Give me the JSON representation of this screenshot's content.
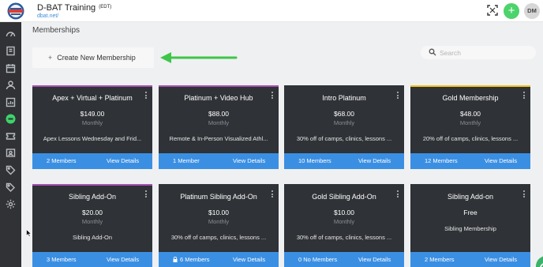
{
  "header": {
    "title": "D-BAT Training",
    "timezone": "(EDT)",
    "url": "dbat.net/",
    "add_symbol": "+",
    "avatar_initials": "DM",
    "icons": [
      "logo-icon",
      "qr-scan-icon",
      "plus-icon"
    ]
  },
  "sidebar": {
    "icons": [
      "dashboard-icon",
      "book-icon",
      "calendar-icon",
      "users-icon",
      "report-icon",
      "dbat-icon",
      "ticket-icon",
      "id-card-icon",
      "tag-icon",
      "tags-icon",
      "gear-icon"
    ],
    "active": "dbat-icon"
  },
  "main": {
    "page_title": "Memberships",
    "create_label": "Create New Membership",
    "create_plus": "+",
    "search_placeholder": "Search"
  },
  "colors": {
    "sidebar_bg": "#303235",
    "card_bg": "#2f3236",
    "card_footer": "#3b8fe3",
    "accent_green": "#4cd36c",
    "arrow_green": "#3fc64a",
    "accent_purple": "#a54fb2",
    "accent_gold": "#f0c419"
  },
  "cards": [
    {
      "title": "Apex + Virtual + Platinum",
      "price": "$149.00",
      "period": "Monthly",
      "description": "Apex Lessons Wednesday and Frid...",
      "members": "2 Members",
      "view": "View Details",
      "accent": "#a54fb2",
      "locked": false
    },
    {
      "title": "Platinum + Video Hub",
      "price": "$88.00",
      "period": "Monthly",
      "description": "Remote & In-Person Visualized Athl...",
      "members": "1 Member",
      "view": "View Details",
      "accent": "#a54fb2",
      "locked": false
    },
    {
      "title": "Intro Platinum",
      "price": "$68.00",
      "period": "Monthly",
      "description": "30% off of camps, clinics, lessons ...",
      "members": "10 Members",
      "view": "View Details",
      "accent": "#2f3236",
      "locked": false
    },
    {
      "title": "Gold Membership",
      "price": "$48.00",
      "period": "Monthly",
      "description": "20% off of camps, clinics, lessons ...",
      "members": "12 Members",
      "view": "View Details",
      "accent": "#f0c419",
      "locked": false
    },
    {
      "title": "Sibling Add-On",
      "price": "$20.00",
      "period": "Monthly",
      "description": "Sibling Add-On",
      "members": "3 Members",
      "view": "View Details",
      "accent": "#a54fb2",
      "locked": false
    },
    {
      "title": "Platinum Sibling Add-On",
      "price": "$10.00",
      "period": "Monthly",
      "description": "30% off of camps, clinics, lessons ...",
      "members": "6 Members",
      "view": "View Details",
      "accent": "#2f3236",
      "locked": true
    },
    {
      "title": "Gold Sibling Add-On",
      "price": "$10.00",
      "period": "Monthly",
      "description": "30% off of camps, clinics, lessons ...",
      "members": "0 No Members",
      "view": "View Details",
      "accent": "#2f3236",
      "locked": false
    },
    {
      "title": "Sibling Add-on",
      "price": "Free",
      "period": "",
      "description": "Sibling Membership",
      "members": "2 Members",
      "view": "View Details",
      "accent": "#2f3236",
      "locked": false
    }
  ]
}
